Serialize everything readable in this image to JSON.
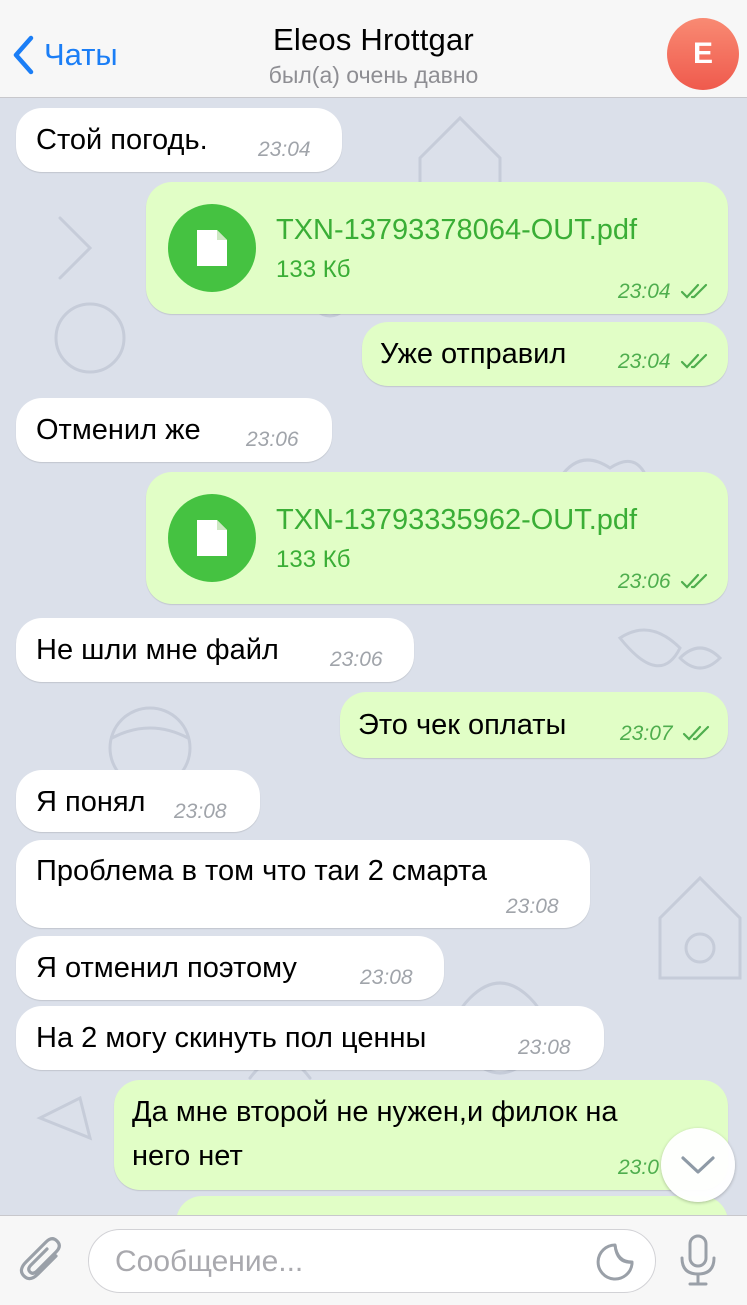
{
  "header": {
    "back_label": "Чаты",
    "title": "Eleos Hrottgar",
    "subtitle": "был(а) очень давно",
    "avatar_letter": "E"
  },
  "messages": [
    {
      "dir": "in",
      "text": "Стой погодь.",
      "time": "23:04"
    },
    {
      "dir": "out",
      "type": "file",
      "file_name": "TXN-13793378064-OUT.pdf",
      "file_size": "133 Кб",
      "time": "23:04"
    },
    {
      "dir": "out",
      "text": "Уже отправил",
      "time": "23:04"
    },
    {
      "dir": "in",
      "text": "Отменил же",
      "time": "23:06"
    },
    {
      "dir": "out",
      "type": "file",
      "file_name": "TXN-13793335962-OUT.pdf",
      "file_size": "133 Кб",
      "time": "23:06"
    },
    {
      "dir": "in",
      "text": "Не шли мне файл",
      "time": "23:06"
    },
    {
      "dir": "out",
      "text": "Это чек оплаты",
      "time": "23:07"
    },
    {
      "dir": "in",
      "text": "Я понял",
      "time": "23:08"
    },
    {
      "dir": "in",
      "text": "Проблема в том что таи 2 смарта",
      "time": "23:08"
    },
    {
      "dir": "in",
      "text": "Я отменил поэтому",
      "time": "23:08"
    },
    {
      "dir": "in",
      "text": "На 2 могу скинуть пол ценны",
      "time": "23:08"
    },
    {
      "dir": "out",
      "text_line1": "Да мне второй не нужен,и филок на",
      "text_line2": "него нет",
      "time": "23:0"
    }
  ],
  "input": {
    "placeholder": "Сообщение..."
  },
  "icons": {
    "back": "chevron-left-icon",
    "file": "document-icon",
    "attach": "paperclip-icon",
    "sticker": "sticker-icon",
    "mic": "microphone-icon",
    "scroll": "chevron-down-icon",
    "read": "double-check-icon"
  },
  "colors": {
    "accent": "#1b7ef6",
    "outgoing_bubble": "#e1fec6",
    "incoming_bubble": "#ffffff",
    "file_green": "#45c241",
    "avatar": "#ef5a4d"
  }
}
